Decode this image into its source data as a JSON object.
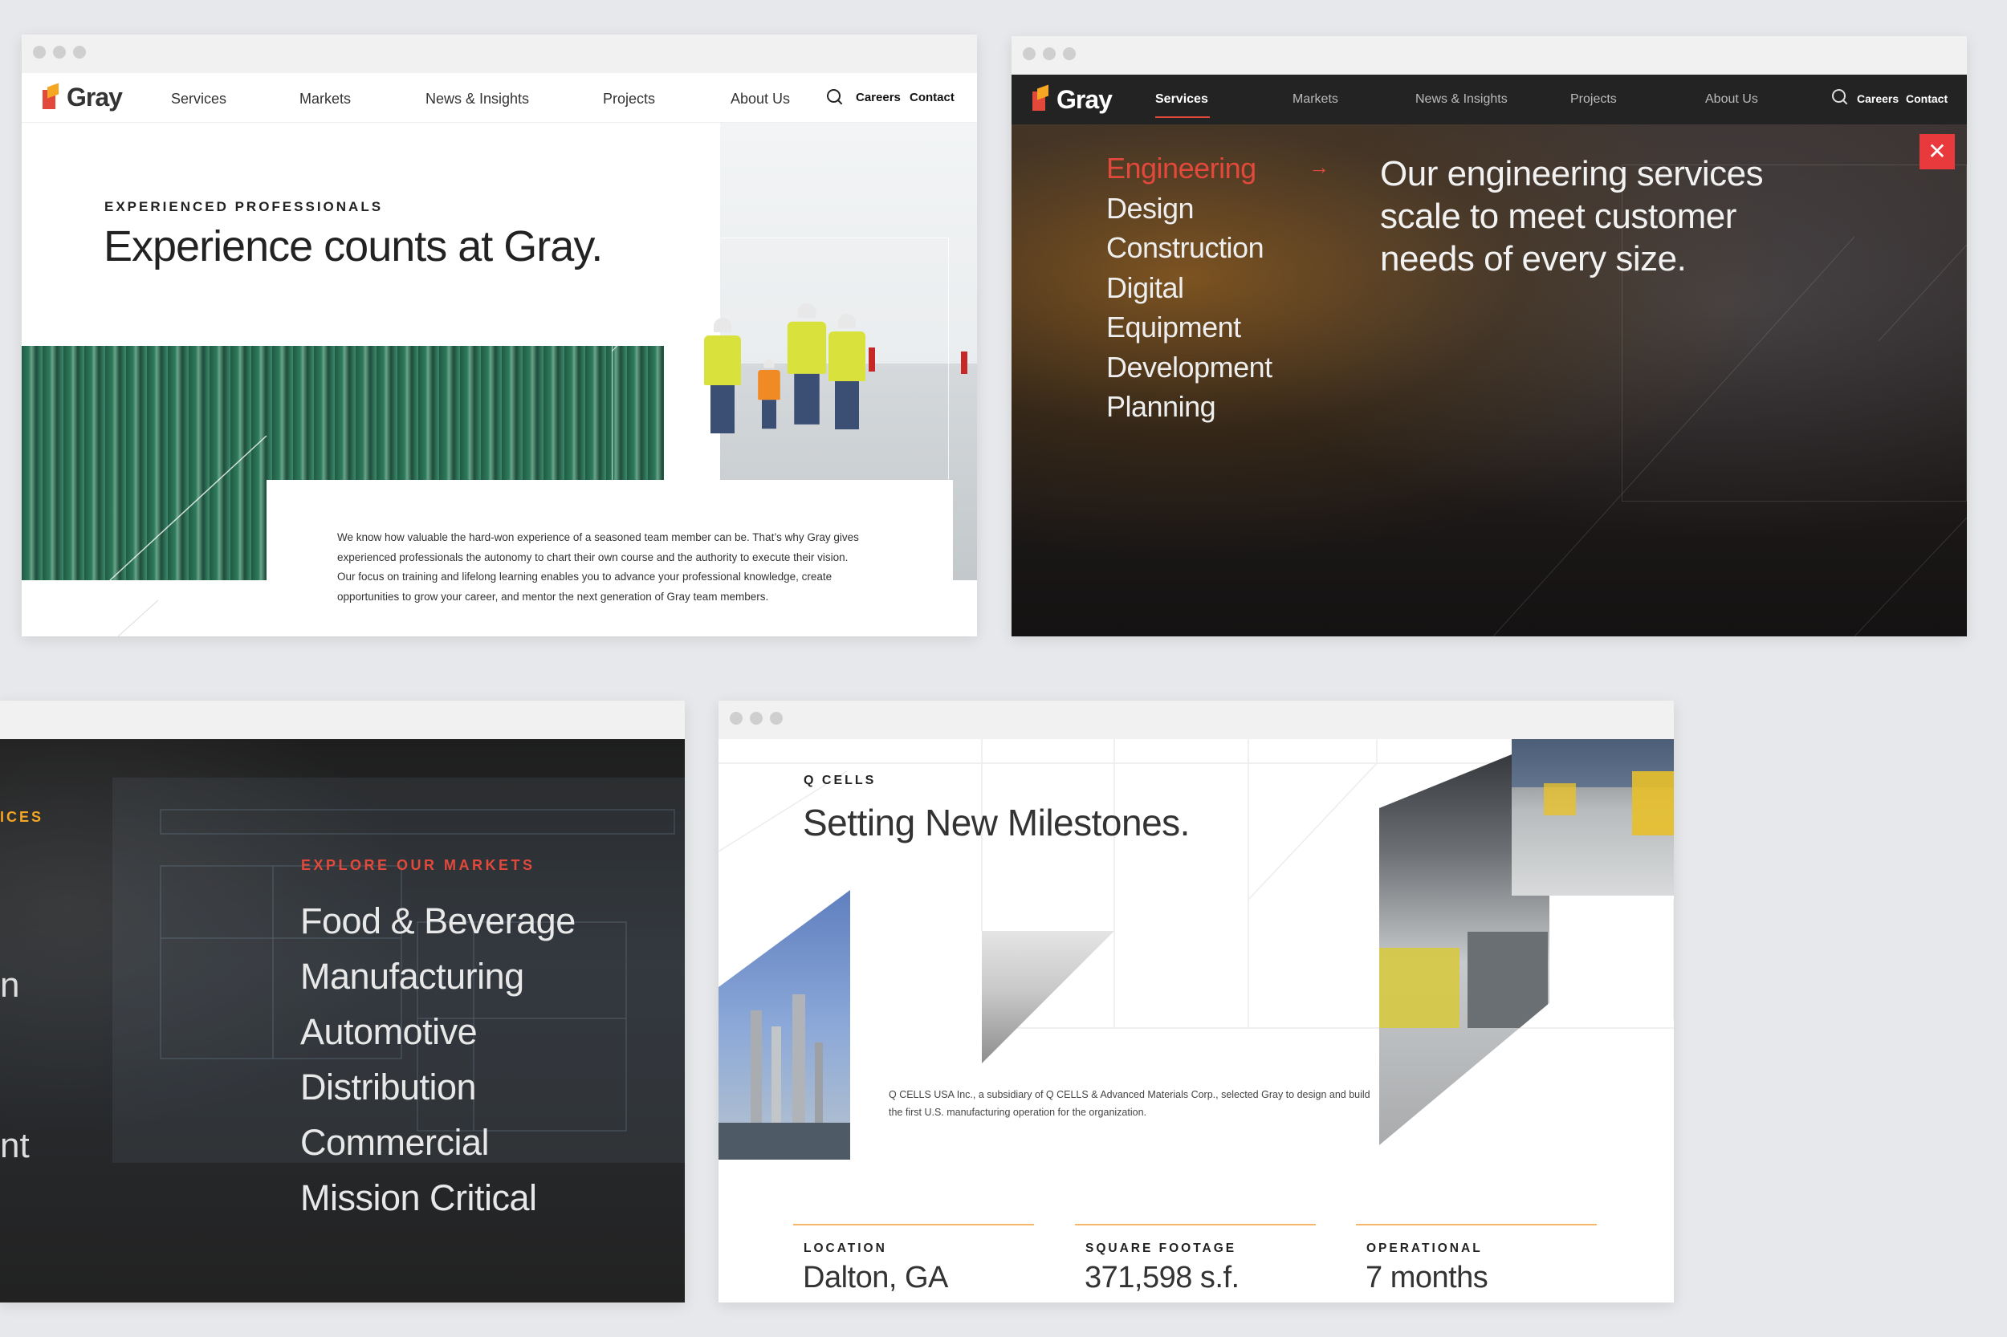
{
  "brand": {
    "name": "Gray",
    "colors": {
      "red": "#e2493b",
      "orange": "#f5a623",
      "yellow": "#ffcc00",
      "stat_rule": "#f5b86a"
    }
  },
  "nav": {
    "items": [
      "Services",
      "Markets",
      "News & Insights",
      "Projects",
      "About Us"
    ],
    "careers": "Careers",
    "contact": "Contact"
  },
  "experienced": {
    "eyebrow": "EXPERIENCED PROFESSIONALS",
    "headline": "Experience counts at Gray.",
    "body": "We know how valuable the hard-won experience of a seasoned team member can be. That’s why Gray gives experienced professionals the autonomy to chart their own course and the authority to execute their vision. Our focus on training and lifelong learning enables you to advance your professional knowledge, create opportunities to grow your career, and mentor the next generation of Gray team members."
  },
  "services_menu": {
    "active_nav": "Services",
    "items": [
      "Engineering",
      "Design",
      "Construction",
      "Digital",
      "Equipment",
      "Development",
      "Planning"
    ],
    "active_item": "Engineering",
    "lead": "Our engineering services scale to meet customer needs of every size."
  },
  "markets_menu": {
    "side_eyebrow": "ICES",
    "eyebrow": "EXPLORE OUR MARKETS",
    "items": [
      "Food & Beverage",
      "Manufacturing",
      "Automotive",
      "Distribution",
      "Commercial",
      "Mission Critical"
    ],
    "side_fragments": [
      "n",
      "nt"
    ]
  },
  "project": {
    "eyebrow": "Q CELLS",
    "headline": "Setting New Milestones.",
    "body": "Q CELLS USA Inc., a subsidiary of Q CELLS & Advanced Materials Corp., selected Gray to design and build the first U.S. manufacturing operation for the organization.",
    "stats": [
      {
        "label": "LOCATION",
        "value": "Dalton, GA"
      },
      {
        "label": "SQUARE FOOTAGE",
        "value": "371,598 s.f."
      },
      {
        "label": "OPERATIONAL",
        "value": "7 months"
      }
    ]
  }
}
